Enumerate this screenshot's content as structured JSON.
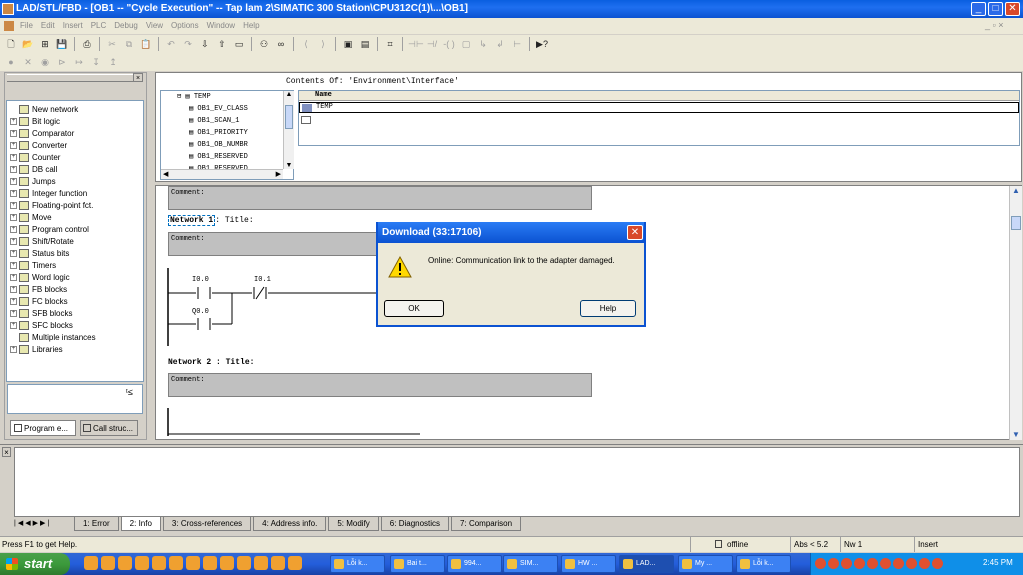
{
  "window": {
    "title": "LAD/STL/FBD - [OB1 -- \"Cycle Execution\" -- Tap lam 2\\SIMATIC 300 Station\\CPU312C(1)\\...\\OB1]"
  },
  "menu": [
    "File",
    "Edit",
    "Insert",
    "PLC",
    "Debug",
    "View",
    "Options",
    "Window",
    "Help"
  ],
  "interface": {
    "contents_of": "Contents Of:  'Environment\\Interface'",
    "tree_root": "TEMP",
    "tree_items": [
      "OB1_EV_CLASS",
      "OB1_SCAN_1",
      "OB1_PRIORITY",
      "OB1_OB_NUMBR",
      "OB1_RESERVED",
      "OB1_RESERVED"
    ],
    "name_header": "Name",
    "row_value": "TEMP"
  },
  "catalog": {
    "items": [
      {
        "label": "New network",
        "icon": "new-network-icon",
        "expand": false
      },
      {
        "label": "Bit logic",
        "icon": "bit-logic-icon",
        "expand": true
      },
      {
        "label": "Comparator",
        "icon": "comparator-icon",
        "expand": true
      },
      {
        "label": "Converter",
        "icon": "converter-icon",
        "expand": true
      },
      {
        "label": "Counter",
        "icon": "counter-icon",
        "expand": true
      },
      {
        "label": "DB call",
        "icon": "db-call-icon",
        "expand": true
      },
      {
        "label": "Jumps",
        "icon": "jumps-icon",
        "expand": true
      },
      {
        "label": "Integer function",
        "icon": "integer-icon",
        "expand": true
      },
      {
        "label": "Floating-point fct.",
        "icon": "floating-icon",
        "expand": true
      },
      {
        "label": "Move",
        "icon": "move-icon",
        "expand": true
      },
      {
        "label": "Program control",
        "icon": "program-control-icon",
        "expand": true
      },
      {
        "label": "Shift/Rotate",
        "icon": "shift-icon",
        "expand": true
      },
      {
        "label": "Status bits",
        "icon": "status-bits-icon",
        "expand": true
      },
      {
        "label": "Timers",
        "icon": "timers-icon",
        "expand": true
      },
      {
        "label": "Word logic",
        "icon": "word-logic-icon",
        "expand": true
      },
      {
        "label": "FB blocks",
        "icon": "fb-blocks-icon",
        "expand": true
      },
      {
        "label": "FC blocks",
        "icon": "fc-blocks-icon",
        "expand": true
      },
      {
        "label": "SFB blocks",
        "icon": "sfb-blocks-icon",
        "expand": true
      },
      {
        "label": "SFC blocks",
        "icon": "sfc-blocks-icon",
        "expand": true
      },
      {
        "label": "Multiple instances",
        "icon": "multi-instance-icon",
        "expand": false
      },
      {
        "label": "Libraries",
        "icon": "libraries-icon",
        "expand": true
      }
    ],
    "tab_program": "Program e...",
    "tab_call": "Call struc..."
  },
  "editor": {
    "comment": "Comment:",
    "network1_label": "Network 1",
    "network1_title": ": Title:",
    "contact1": "I0.0",
    "contact2": "I0.1",
    "contact3": "Q0.0",
    "network2": "Network 2 : Title:"
  },
  "dialog": {
    "title": "Download (33:17106)",
    "message": "Online: Communication link to the adapter damaged.",
    "ok": "OK",
    "help": "Help"
  },
  "output_tabs": [
    "1: Error",
    "2: Info",
    "3: Cross-references",
    "4: Address info.",
    "5: Modify",
    "6: Diagnostics",
    "7: Comparison"
  ],
  "status": {
    "help": "Press F1 to get Help.",
    "mode": "offline",
    "abs": "Abs < 5.2",
    "nw": "Nw 1",
    "insert": "Insert"
  },
  "taskbar": {
    "start": "start",
    "buttons": [
      "Lỗi k...",
      "Bai t...",
      "994...",
      "SIM...",
      "HW ...",
      "LAD...",
      "My ...",
      "Lỗi k..."
    ],
    "clock": "2:45 PM"
  },
  "colors": {
    "title_blue": "#0b52d1",
    "taskbar_blue": "#245edb",
    "start_green": "#3c9a3c",
    "comment_gray": "#c0c0c0"
  }
}
